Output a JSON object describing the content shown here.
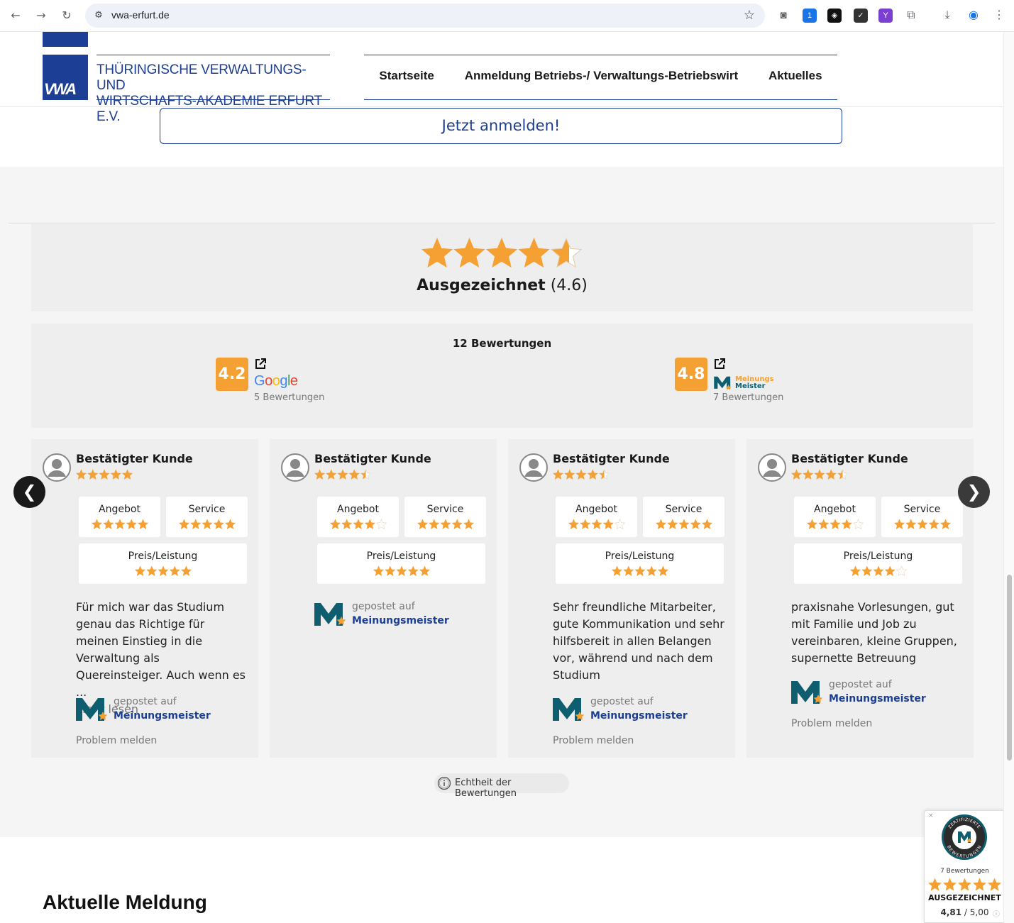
{
  "browser": {
    "url": "vwa-erfurt.de",
    "ext_badge": "1"
  },
  "header": {
    "logo_mark": "VWA",
    "logo_line1": "THÜRINGISCHE VERWALTUNGS- UND",
    "logo_line2": "WIRTSCHAFTS-AKADEMIE ERFURT E.V.",
    "nav": [
      "Startseite",
      "Anmeldung Betriebs-/ Verwaltungs-Betriebswirt",
      "Aktuelles"
    ]
  },
  "cta": {
    "label": "Jetzt anmelden!"
  },
  "summary": {
    "rating_label": "Ausgezeichnet",
    "rating_value": "(4.6)",
    "stars": 4.6
  },
  "platforms": {
    "total": "12 Bewertungen",
    "items": [
      {
        "score": "4.2",
        "name": "Google",
        "count": "5 Bewertungen"
      },
      {
        "score": "4.8",
        "name_line1": "Meinungs",
        "name_line2": "Meister",
        "count": "7 Bewertungen"
      }
    ]
  },
  "reviews": [
    {
      "author": "Bestätigter Kunde",
      "stars": 5,
      "criteria": [
        {
          "label": "Angebot",
          "stars": 5
        },
        {
          "label": "Service",
          "stars": 5
        },
        {
          "label": "Preis/Leistung",
          "stars": 5
        }
      ],
      "text": "Für mich war das Studium genau das Richtige für meinen Einstieg in die Verwaltung als Quereinsteiger. Auch wenn es ...",
      "more": "Mehr lesen",
      "posted_label": "gepostet auf",
      "posted_site": "Meinungsmeister",
      "report": "Problem melden"
    },
    {
      "author": "Bestätigter Kunde",
      "stars": 4.5,
      "criteria": [
        {
          "label": "Angebot",
          "stars": 4
        },
        {
          "label": "Service",
          "stars": 5
        },
        {
          "label": "Preis/Leistung",
          "stars": 5
        }
      ],
      "text": "",
      "posted_label": "gepostet auf",
      "posted_site": "Meinungsmeister"
    },
    {
      "author": "Bestätigter Kunde",
      "stars": 4.5,
      "criteria": [
        {
          "label": "Angebot",
          "stars": 4
        },
        {
          "label": "Service",
          "stars": 5
        },
        {
          "label": "Preis/Leistung",
          "stars": 5
        }
      ],
      "text": "Sehr freundliche Mitarbeiter, gute Kommunikation und sehr hilfsbereit in allen Belangen vor, während und nach dem Studium",
      "posted_label": "gepostet auf",
      "posted_site": "Meinungsmeister",
      "report": "Problem melden"
    },
    {
      "author": "Bestätigter Kunde",
      "stars": 4.5,
      "criteria": [
        {
          "label": "Angebot",
          "stars": 4
        },
        {
          "label": "Service",
          "stars": 5
        },
        {
          "label": "Preis/Leistung",
          "stars": 4
        }
      ],
      "text": "praxisnahe Vorlesungen, gut mit Familie und Job zu vereinbaren, kleine Gruppen, supernette Betreuung",
      "posted_label": "gepostet auf",
      "posted_site": "Meinungsmeister",
      "report": "Problem melden"
    }
  ],
  "authenticity": {
    "label": "Echtheit der Bewertungen"
  },
  "news": {
    "title": "Aktuelle Meldung"
  },
  "widget": {
    "close": "×",
    "seal_top": "ZERTIFIZIERTE",
    "seal_bottom": "BEWERTUNGEN",
    "count": "7 Bewertungen",
    "stars": 5,
    "label": "AUSGEZEICHNET",
    "score": "4,81",
    "score_max": "/ 5,00"
  },
  "colors": {
    "brand_blue": "#1c3e94",
    "star_orange": "#f5a033",
    "mm_teal": "#0e5e6f"
  }
}
